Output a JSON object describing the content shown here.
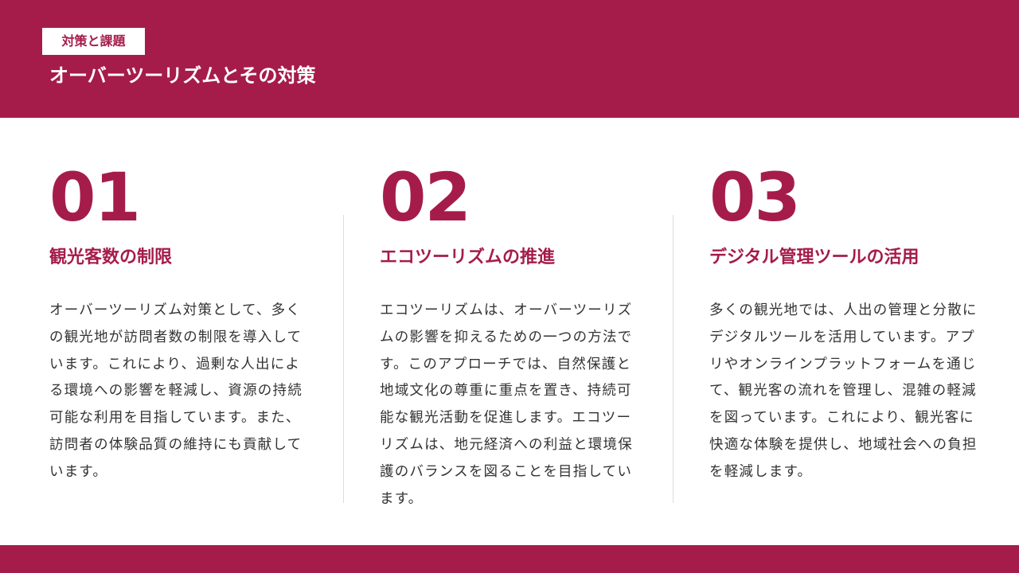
{
  "header": {
    "tag": "対策と課題",
    "title": "オーバーツーリズムとその対策"
  },
  "columns": [
    {
      "number": "01",
      "heading": "観光客数の制限",
      "body": "オーバーツーリズム対策として、多くの観光地が訪問者数の制限を導入しています。これにより、過剰な人出による環境への影響を軽減し、資源の持続可能な利用を目指しています。また、訪問者の体験品質の維持にも貢献しています。"
    },
    {
      "number": "02",
      "heading": "エコツーリズムの推進",
      "body": "エコツーリズムは、オーバーツーリズムの影響を抑えるための一つの方法です。このアプローチでは、自然保護と地域文化の尊重に重点を置き、持続可能な観光活動を促進します。エコツーリズムは、地元経済への利益と環境保護のバランスを図ることを目指しています。"
    },
    {
      "number": "03",
      "heading": "デジタル管理ツールの活用",
      "body": "多くの観光地では、人出の管理と分散にデジタルツールを活用しています。アプリやオンラインプラットフォームを通じて、観光客の流れを管理し、混雑の軽減を図っています。これにより、観光客に快適な体験を提供し、地域社会への負担を軽減します。"
    }
  ],
  "colors": {
    "accent": "#a51c4b",
    "text": "#333333",
    "divider": "#dddddd"
  }
}
